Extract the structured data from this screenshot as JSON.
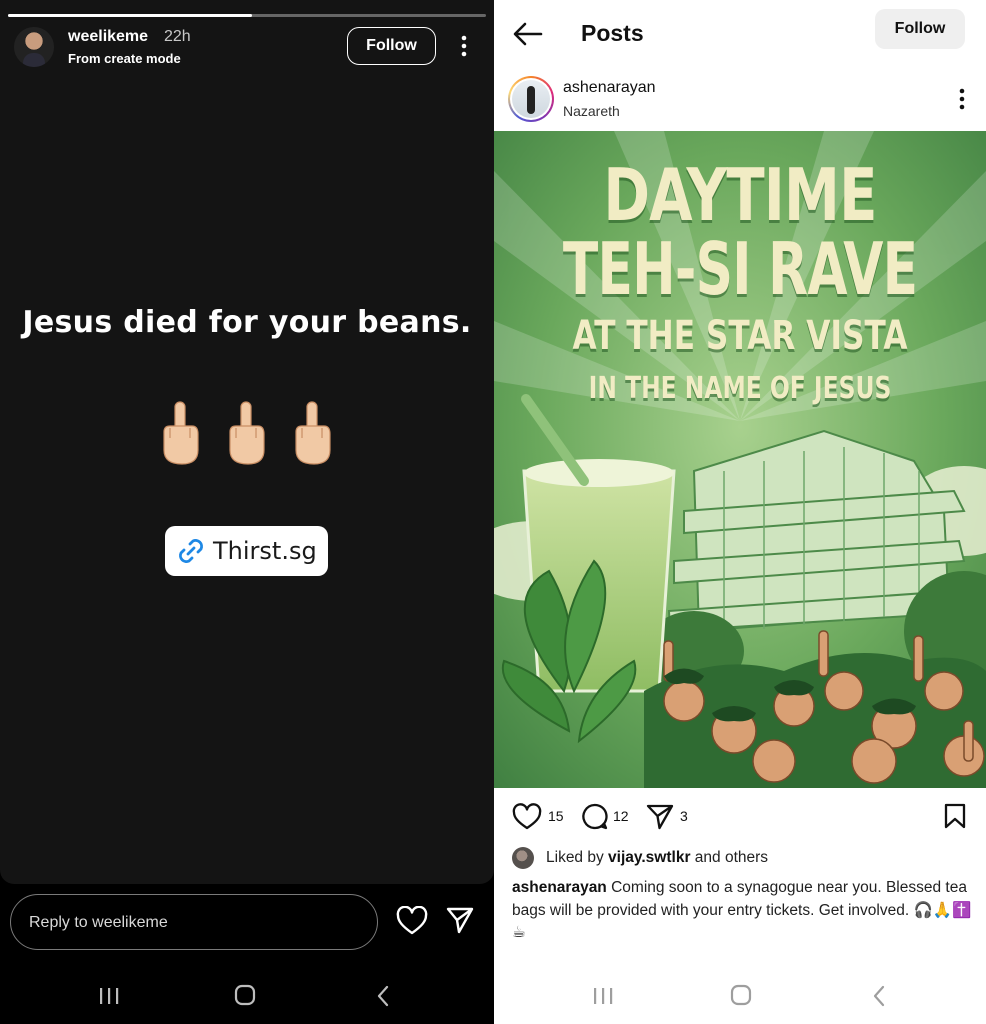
{
  "story": {
    "progress": 0.51,
    "username": "weelikeme",
    "time_ago": "22h",
    "subtitle": "From create mode",
    "follow_label": "Follow",
    "text": "Jesus died for your beans.",
    "emoji_count": 3,
    "emoji_icon": "middle-finger-emoji",
    "link_label": "Thirst.sg",
    "reply_placeholder": "Reply to weelikeme"
  },
  "post": {
    "header_title": "Posts",
    "follow_label": "Follow",
    "username": "ashenarayan",
    "location": "Nazareth",
    "poster_lines": [
      "DAYTIME",
      "TEH-SI RAVE",
      "AT THE STAR VISTA",
      "IN THE NAME OF JESUS"
    ],
    "likes_count": "15",
    "comments_count": "12",
    "shares_count": "3",
    "liked_by_prefix": "Liked by",
    "liked_by_user": "vijay.swtlkr",
    "liked_by_suffix": "and others",
    "caption_user": "ashenarayan",
    "caption_text": "Coming soon to a synagogue near you. Blessed tea bags will be provided with your entry tickets. Get involved. 🎧🙏✝️☕",
    "colors": {
      "poster_green": "#5f9e55",
      "poster_text": "#f1ecc4",
      "instagram_gradient": [
        "#f58529",
        "#dd2a7b",
        "#8134af"
      ]
    }
  },
  "system_nav": {
    "icons": [
      "recents-icon",
      "home-icon",
      "back-icon"
    ]
  }
}
